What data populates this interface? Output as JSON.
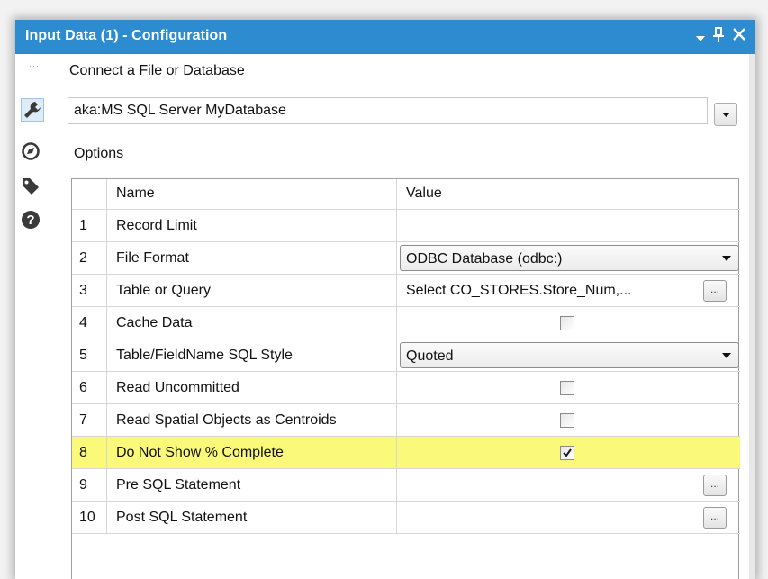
{
  "window": {
    "title": "Input Data (1) - Configuration",
    "title_bar_color": "#2d8ccf"
  },
  "sidebar": {
    "items": [
      {
        "icon": "wrench-icon",
        "active": true
      },
      {
        "icon": "compass-icon",
        "active": false
      },
      {
        "icon": "tag-icon",
        "active": false
      },
      {
        "icon": "help-icon",
        "active": false
      }
    ]
  },
  "connect": {
    "label": "Connect a File or Database",
    "value": "aka:MS SQL Server MyDatabase"
  },
  "options": {
    "label": "Options",
    "columns": {
      "name": "Name",
      "value": "Value"
    },
    "rows": [
      {
        "num": "1",
        "name": "Record Limit",
        "type": "text",
        "value": ""
      },
      {
        "num": "2",
        "name": "File Format",
        "type": "select",
        "value": "ODBC Database (odbc:)"
      },
      {
        "num": "3",
        "name": "Table or Query",
        "type": "text-ellipsis",
        "value": "Select  CO_STORES.Store_Num,..."
      },
      {
        "num": "4",
        "name": "Cache Data",
        "type": "checkbox",
        "checked": false
      },
      {
        "num": "5",
        "name": "Table/FieldName SQL Style",
        "type": "select",
        "value": "Quoted"
      },
      {
        "num": "6",
        "name": "Read Uncommitted",
        "type": "checkbox",
        "checked": false
      },
      {
        "num": "7",
        "name": "Read Spatial Objects as Centroids",
        "type": "checkbox",
        "checked": false
      },
      {
        "num": "8",
        "name": "Do Not Show % Complete",
        "type": "checkbox",
        "checked": true,
        "highlighted": true
      },
      {
        "num": "9",
        "name": "Pre SQL Statement",
        "type": "ellipsis",
        "value": ""
      },
      {
        "num": "10",
        "name": "Post SQL Statement",
        "type": "ellipsis",
        "value": ""
      }
    ],
    "highlight_color": "#faf97a"
  },
  "ellipsis_label": "..."
}
